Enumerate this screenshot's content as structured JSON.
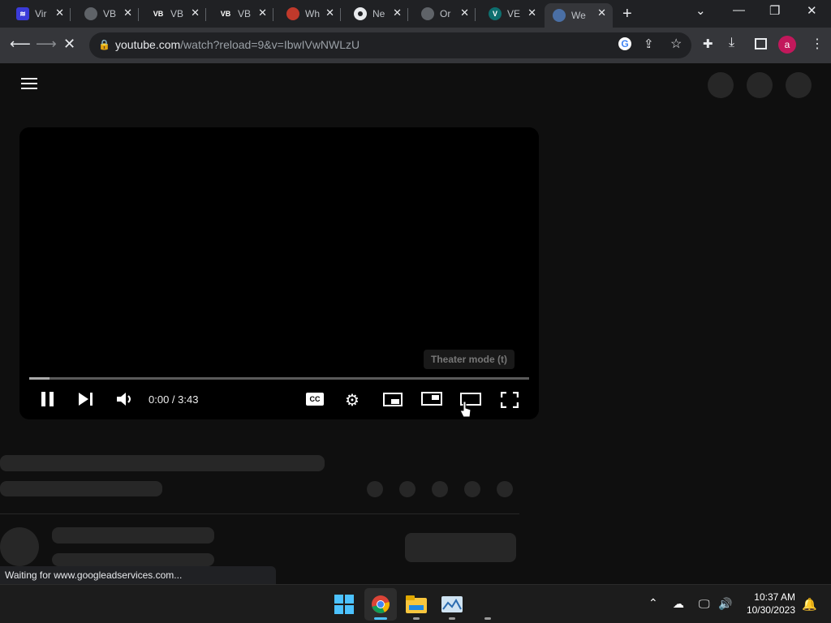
{
  "tabs": [
    {
      "title": "Vir",
      "icon": "vir-favicon-icon",
      "color": "#3b3bd9"
    },
    {
      "title": "VB",
      "icon": "globe-icon",
      "color": "#5f6368"
    },
    {
      "title": "VB",
      "icon": "vb-logo-icon",
      "color": "#202124"
    },
    {
      "title": "VB",
      "icon": "vb-logo-icon",
      "color": "#202124"
    },
    {
      "title": "Wh",
      "icon": "red-favicon-icon",
      "color": "#c0392b"
    },
    {
      "title": "Ne",
      "icon": "chrome-icon",
      "color": "#5f6368"
    },
    {
      "title": "Or",
      "icon": "globe-icon",
      "color": "#5f6368"
    },
    {
      "title": "VE",
      "icon": "v-favicon-icon",
      "color": "#0e6f6f"
    },
    {
      "title": "We",
      "icon": "loading-globe-icon",
      "color": "#4a6fa5"
    }
  ],
  "vb_glyph": "VB",
  "v_glyph": "V",
  "url": {
    "host": "youtube.com",
    "path": "/watch?reload=9&v=IbwIVwNWLzU"
  },
  "profile_initial": "a",
  "player": {
    "time": "0:00 / 3:43",
    "progress_fraction": 0.0,
    "buffered_fraction": 0.04,
    "tooltip": "Theater mode (t)",
    "cc_label": "CC"
  },
  "status_text": "Waiting for www.googleadservices.com...",
  "clock": {
    "time": "10:37 AM",
    "date": "10/30/2023"
  },
  "colors": {
    "accent_profile": "#c2185b",
    "page_bg": "#0f0f0f",
    "skeleton": "#272727"
  }
}
